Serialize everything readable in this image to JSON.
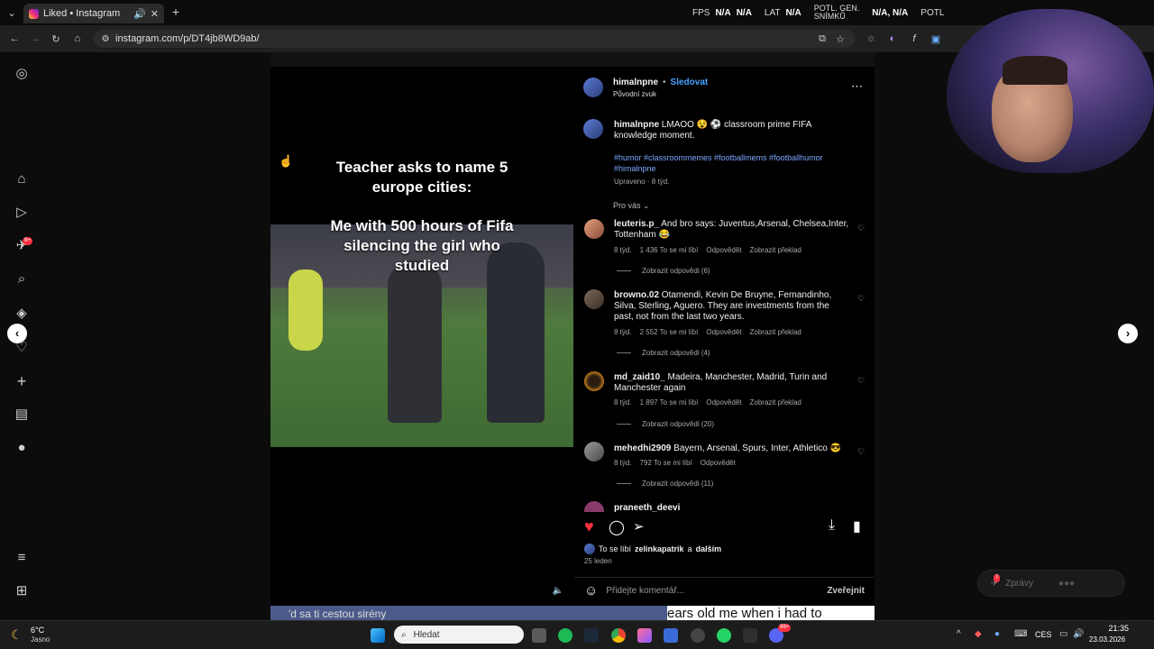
{
  "browser": {
    "tab_title": "Liked • Instagram",
    "url": "instagram.com/p/DT4jb8WD9ab/"
  },
  "osd": {
    "fps_label": "FPS",
    "fps_value1": "N/A",
    "fps_value2": "N/A",
    "lat_label": "LAT",
    "lat_value": "N/A",
    "potl_gen_label": "POTL. GEN.",
    "snimku_label": "SNÍMKŮ",
    "gen_value": "N/A, N/A",
    "potl2_label": "POTL",
    "potl2_value": "N/A"
  },
  "nav": {
    "notification_badge": "9+"
  },
  "post": {
    "author": "himalnpne",
    "follow_label": "Sledovat",
    "audio_label": "Původní zvuk",
    "caption_text": "LMAOO 😵 ⚽ classroom prime FIFA knowledge moment.",
    "hashtags": "#humor #classroommemes #footballmems #footballhumor #himalnpne",
    "edited": "Upraveno · 8 týd.",
    "video_caption_top": "Teacher asks to name 5 europe cities:",
    "video_caption_mid": "Me with 500 hours of Fifa silencing the girl who studied",
    "sort_label": "Pro vás",
    "likes_prefix": "To se líbí",
    "likes_user": "zelinkapatrik",
    "likes_and": "a",
    "likes_more": "dalším",
    "date": "25 leden",
    "comment_placeholder": "Přidejte komentář...",
    "post_button": "Zveřejnit"
  },
  "comments": [
    {
      "user": "leuteris.p_",
      "text": "And bro says: Juventus,Arsenal, Chelsea,Inter, Tottenham 😂",
      "age": "8 týd.",
      "likes": "1 436 To se mi líbí",
      "reply": "Odpovědět",
      "translate": "Zobrazit překlad",
      "replies": "Zobrazit odpovědi (6)"
    },
    {
      "user": "browno.02",
      "text": "Otamendi, Kevin De Bruyne, Fernandinho, Silva, Sterling, Aguero. They are investments from the past, not from the last two years.",
      "age": "8 týd.",
      "likes": "2 552 To se mi líbí",
      "reply": "Odpovědět",
      "translate": "Zobrazit překlad",
      "replies": "Zobrazit odpovědi (4)"
    },
    {
      "user": "md_zaid10_",
      "text": "Madeira, Manchester, Madrid, Turin and Manchester again",
      "age": "8 týd.",
      "likes": "1 897 To se mi líbí",
      "reply": "Odpovědět",
      "translate": "Zobrazit překlad",
      "replies": "Zobrazit odpovědi (20)"
    },
    {
      "user": "mehedhi2909",
      "text": "Bayern, Arsenal, Spurs, Inter, Athletico 😎",
      "age": "8 týd.",
      "likes": "792 To se mi líbí",
      "reply": "Odpovědět",
      "translate": "",
      "replies": "Zobrazit odpovědi (11)"
    },
    {
      "user": "praneeth_deevi",
      "text": "",
      "age": "",
      "likes": "",
      "reply": "",
      "translate": "",
      "replies": ""
    }
  ],
  "messages": {
    "label": "Zprávy",
    "badge": "7"
  },
  "bottom_strip": {
    "left_text": "'d sa ti cestou sirény",
    "right_text": "ears old me when i had to"
  },
  "taskbar": {
    "weather_temp": "6°C",
    "weather_desc": "Jasno",
    "search_placeholder": "Hledat",
    "language": "CES",
    "time": "21:35",
    "date": "23.03.2026",
    "notif_badge": "99+"
  }
}
